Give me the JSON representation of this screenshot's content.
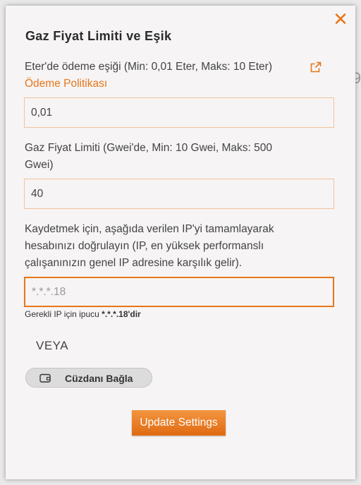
{
  "background": {
    "fragment": "9"
  },
  "modal": {
    "title": "Gaz Fiyat Limiti ve Eşik",
    "close_icon": "close-icon",
    "threshold": {
      "label": "Eter'de ödeme eşiği (Min: 0,01 Eter, Maks: 10 Eter)",
      "policy_link": "Ödeme Politikası",
      "value": "0,01"
    },
    "gas_limit": {
      "label_line1": "Gaz Fiyat Limiti (Gwei'de, Min: 10 Gwei, Maks: 500",
      "label_line2": "Gwei)",
      "value": "40"
    },
    "ip_verify": {
      "label_line1": "Kaydetmek için, aşağıda verilen IP'yi tamamlayarak",
      "label_line2": "hesabınızı doğrulayın (IP, en yüksek performanslı",
      "label_line3": "çalışanınızın genel IP adresine karşılık gelir).",
      "placeholder": "*.*.*.18",
      "value": "",
      "hint_prefix": "Gerekli IP için ipucu ",
      "hint_value": "*.*.*.18'dir"
    },
    "or_label": "VEYA",
    "wallet_button": {
      "label": "Cüzdanı Bağla",
      "icon": "wallet-icon"
    },
    "update_button": {
      "label": "Update Settings"
    }
  },
  "colors": {
    "accent": "#e8761a",
    "field_border": "#f2c39d",
    "modal_bg": "#f6f4f4"
  }
}
